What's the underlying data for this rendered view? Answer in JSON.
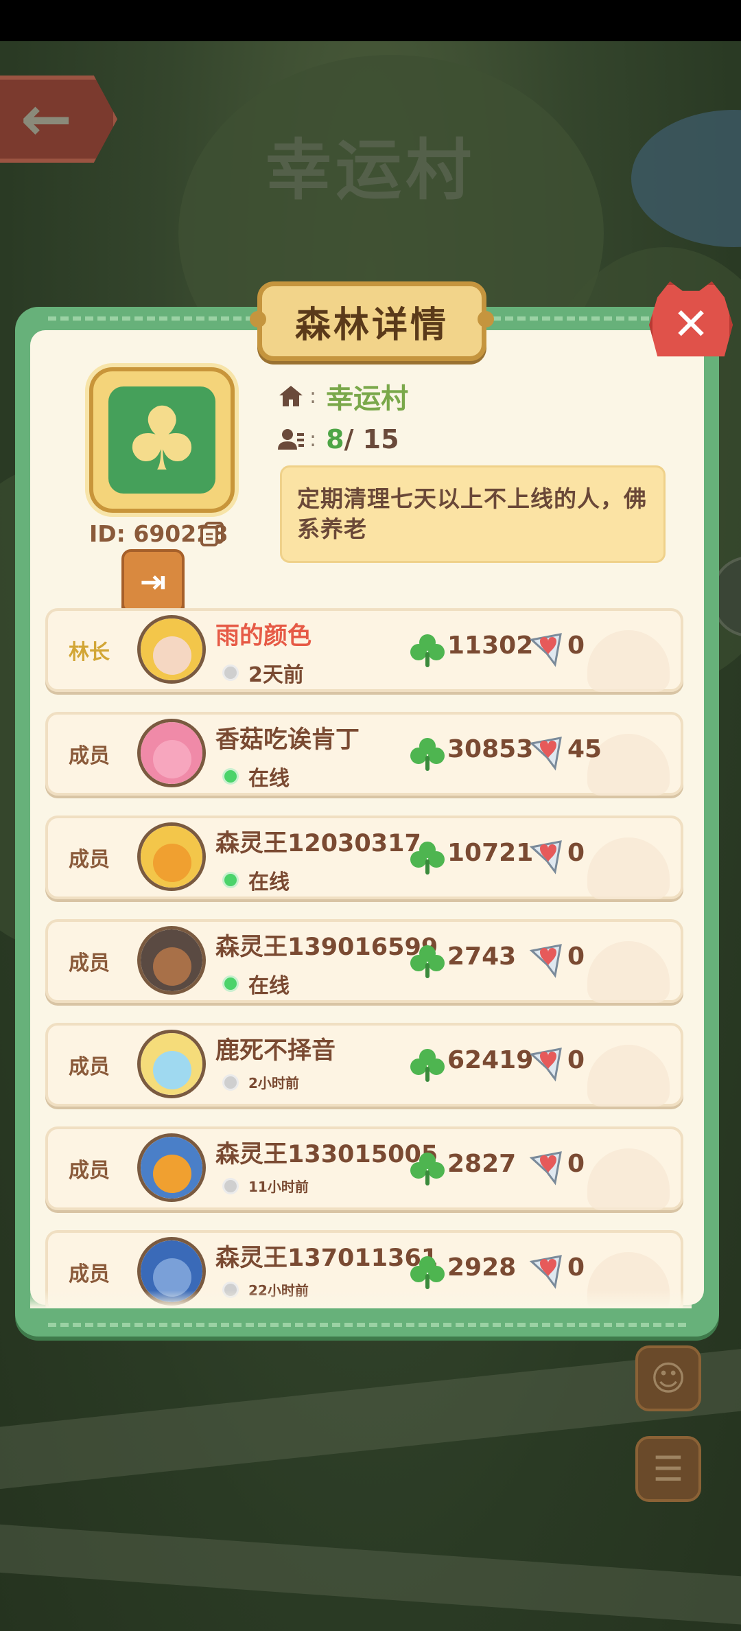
{
  "background": {
    "title": "幸运村"
  },
  "modal": {
    "title": "森林详情",
    "forest_id": "ID: 690228",
    "village_name": "幸运村",
    "member_count": "8",
    "member_max": "/ 15",
    "notice": "定期清理七天以上不上线的人，佛系养老"
  },
  "members": [
    {
      "role": "林长",
      "name": "雨的颜色",
      "status": "2天前",
      "online": false,
      "points": "11302",
      "likes": "0",
      "ring": "#f3c64a",
      "face": "#f5d7c2"
    },
    {
      "role": "成员",
      "name": "香菇吃诶肯丁",
      "status": "在线",
      "online": true,
      "points": "30853",
      "likes": "45",
      "ring": "#f08aa8",
      "face": "#f7a6be"
    },
    {
      "role": "成员",
      "name": "森灵王12030317",
      "status": "在线",
      "online": true,
      "points": "10721",
      "likes": "0",
      "ring": "#f3c64a",
      "face": "#f0a030"
    },
    {
      "role": "成员",
      "name": "森灵王139016599",
      "status": "在线",
      "online": true,
      "points": "2743",
      "likes": "0",
      "ring": "#5a4a42",
      "face": "#a87048"
    },
    {
      "role": "成员",
      "name": "鹿死不择音",
      "status": "2小时前",
      "online": false,
      "points": "62419",
      "likes": "0",
      "ring": "#f5dc7a",
      "face": "#9fd9f0"
    },
    {
      "role": "成员",
      "name": "森灵王133015005",
      "status": "11小时前",
      "online": false,
      "points": "2827",
      "likes": "0",
      "ring": "#4a7fc8",
      "face": "#f0a030"
    },
    {
      "role": "成员",
      "name": "森灵王137011361",
      "status": "22小时前",
      "online": false,
      "points": "2928",
      "likes": "0",
      "ring": "#3a6ab8",
      "face": "#7aa0d8"
    }
  ],
  "colors": {
    "accent_green": "#67b17a",
    "leader_name": "#e65a46",
    "online_dot": "#4bd36a"
  },
  "icons": {
    "back": "arrow-left-icon",
    "close": "close-icon",
    "copy": "copy-icon",
    "exit": "exit-icon",
    "home": "home-icon",
    "people": "people-icon",
    "clover": "clover-icon",
    "heart": "heart-icon",
    "chat": "chat-icon",
    "profile": "profile-icon"
  }
}
